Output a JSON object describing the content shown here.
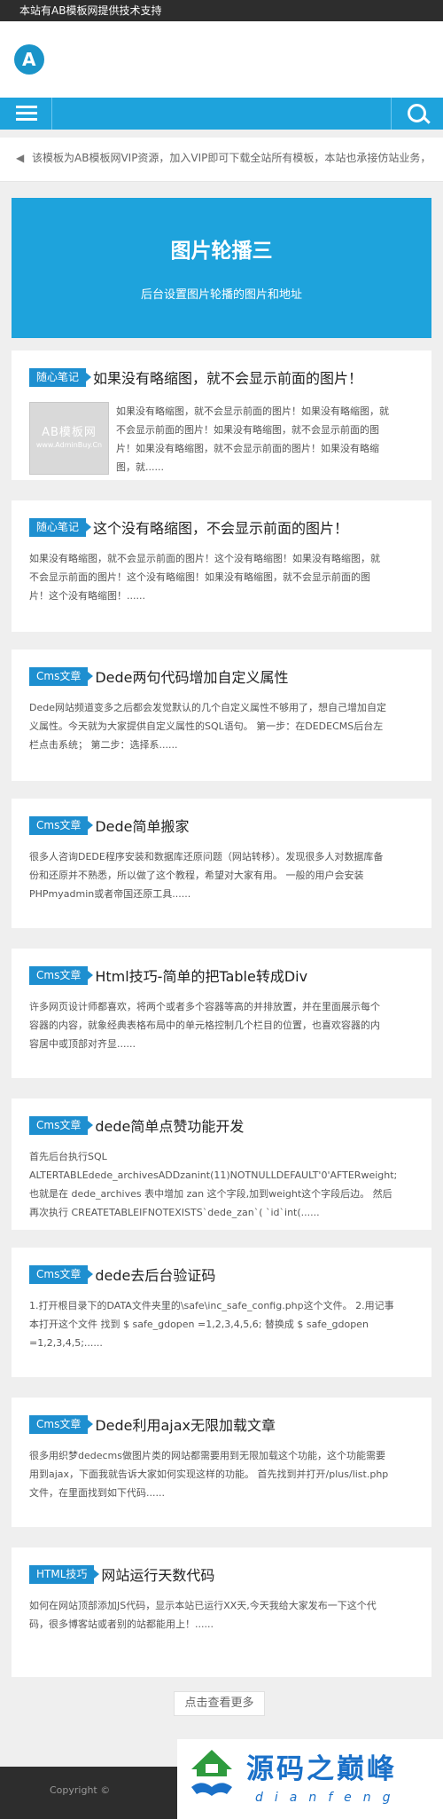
{
  "topbar": {
    "text": "本站有AB模板网提供技术支持"
  },
  "notice": {
    "text": "该模板为AB模板网VIP资源，加入VIP即可下载全站所有模板，本站也承接仿站业务，"
  },
  "banner": {
    "title": "图片轮播三",
    "subtitle": "后台设置图片轮播的图片和地址"
  },
  "posts": [
    {
      "badge": "随心笔记",
      "title": "如果没有略缩图，就不会显示前面的图片！",
      "excerpt_lines": [
        "如果没有略缩图，就不会显示前面的图片！如果没有略缩图，就",
        "不会显示前面的图片！如果没有略缩图，就不会显示前面的图",
        "片！如果没有略缩图，就不会显示前面的图片！如果没有略缩",
        "图，就......"
      ],
      "thumb": {
        "line1": "AB模板网",
        "line2": "www.AdminBuy.Cn"
      }
    },
    {
      "badge": "随心笔记",
      "title": "这个没有略缩图，不会显示前面的图片！",
      "excerpt_lines": [
        "如果没有略缩图，就不会显示前面的图片！这个没有略缩图！如果没有略缩图，就",
        "不会显示前面的图片！这个没有略缩图！如果没有略缩图，就不会显示前面的图",
        "片！这个没有略缩图！......"
      ]
    },
    {
      "badge": "Cms文章",
      "title": "Dede两句代码增加自定义属性",
      "excerpt_lines": [
        "Dede网站频道变多之后都会发觉默认的几个自定义属性不够用了，想自己增加自定",
        "义属性。今天就为大家提供自定义属性的SQL语句。 第一步：在DEDECMS后台左",
        "栏点击系统； 第二步：选择系......"
      ]
    },
    {
      "badge": "Cms文章",
      "title": "Dede简单搬家",
      "excerpt_lines": [
        "很多人咨询DEDE程序安装和数据库还原问题（网站转移）。发现很多人对数据库备",
        "份和还原并不熟悉，所以做了这个教程，希望对大家有用。 一般的用户会安装",
        "PHPmyadmin或者帝国还原工具......"
      ]
    },
    {
      "badge": "Cms文章",
      "title": "Html技巧-简单的把Table转成Div",
      "excerpt_lines": [
        "许多网页设计师都喜欢，将两个或者多个容器等高的并排放置，并在里面展示每个",
        "容器的内容，就象经典表格布局中的单元格控制几个栏目的位置，也喜欢容器的内",
        "容居中或顶部对齐显......"
      ]
    },
    {
      "badge": "Cms文章",
      "title": "dede简单点赞功能开发",
      "excerpt_lines": [
        "首先后台执行SQL",
        "ALTERTABLEdede_archivesADDzanint(11)NOTNULLDEFAULT'0'AFTERweight;",
        "也就是在 dede_archives 表中增加 zan 这个字段,加到weight这个字段后边。 然后",
        "再次执行 CREATETABLEIFNOTEXISTS`dede_zan`( `id`int(......"
      ]
    },
    {
      "badge": "Cms文章",
      "title": "dede去后台验证码",
      "excerpt_lines": [
        "1.打开根目录下的DATA文件夹里的\\safe\\inc_safe_config.php这个文件。 2.用记事",
        "本打开这个文件 找到 $ safe_gdopen =1,2,3,4,5,6; 替换成 $ safe_gdopen",
        "=1,2,3,4,5;......"
      ]
    },
    {
      "badge": "Cms文章",
      "title": "Dede利用ajax无限加载文章",
      "excerpt_lines": [
        "很多用织梦dedecms做图片类的网站都需要用到无限加载这个功能，这个功能需要",
        "用到ajax，下面我就告诉大家如何实现这样的功能。 首先找到并打开/plus/list.php",
        "文件，在里面找到如下代码......"
      ]
    },
    {
      "badge": "HTML技巧",
      "title": "网站运行天数代码",
      "excerpt_lines": [
        "如何在网站顶部添加JS代码，显示本站已运行XX天,今天我给大家发布一下这个代",
        "码，很多博客站或者别的站都能用上！......"
      ]
    }
  ],
  "more": {
    "label": "点击查看更多"
  },
  "footer": {
    "copyright": "Copyright ©"
  },
  "watermark": {
    "title": "源码之巅峰",
    "sub": "dianfeng"
  },
  "colors": {
    "accent": "#1ea3dc",
    "badge": "#1e8fd0",
    "dark": "#2d2d2d"
  }
}
